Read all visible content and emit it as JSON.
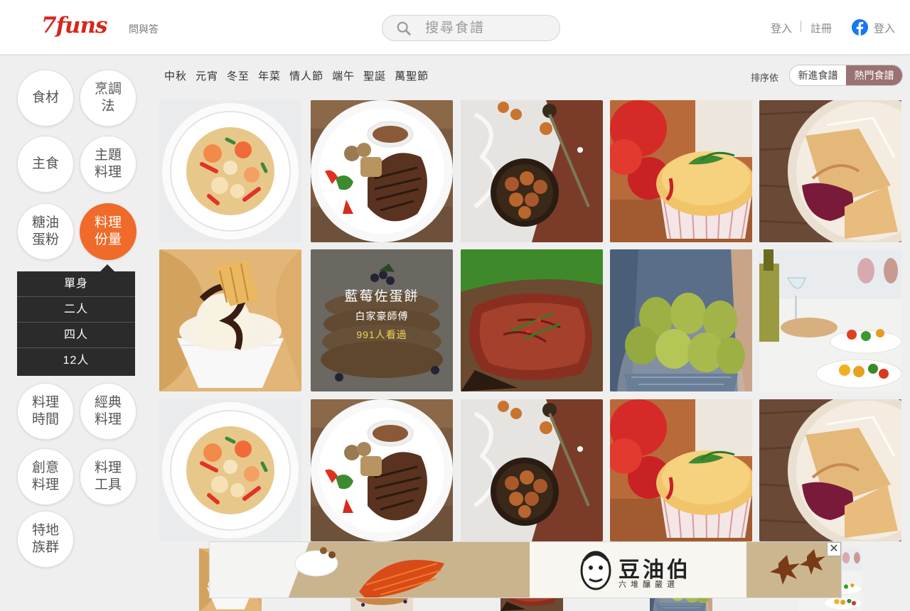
{
  "header": {
    "logo": "7funs",
    "qa_link": "問與答",
    "search_placeholder": "搜尋食譜",
    "login": "登入",
    "register": "註冊",
    "fb_login": "登入"
  },
  "sidebar": {
    "categories": [
      {
        "label": "食材"
      },
      {
        "label": "烹調\n法"
      },
      {
        "label": "主食"
      },
      {
        "label": "主題\n料理"
      },
      {
        "label": "糖油\n蛋粉"
      },
      {
        "label": "料理\n份量",
        "active": true
      },
      {
        "label": "料理\n時間"
      },
      {
        "label": "經典\n料理"
      },
      {
        "label": "創意\n料理"
      },
      {
        "label": "料理\n工具"
      },
      {
        "label": "特地\n族群"
      }
    ],
    "submenu": [
      "單身",
      "二人",
      "四人",
      "12人"
    ]
  },
  "holidays": [
    "中秋",
    "元宵",
    "冬至",
    "年菜",
    "情人節",
    "端午",
    "聖誕",
    "萬聖節"
  ],
  "sort": {
    "label": "排序依",
    "options": [
      "新進食譜",
      "熱門食譜"
    ],
    "active": "熱門食譜"
  },
  "featured": {
    "title": "藍莓佐蛋餅",
    "chef": "白家豪師傅",
    "views": "991人看過"
  },
  "ad": {
    "brand": "豆油伯",
    "tagline": "六堆釀嚴選",
    "close": "✕"
  },
  "colors": {
    "brand_red": "#d7261e",
    "active_orange": "#f06a2a",
    "sort_active": "#9a7272",
    "views_yellow": "#f3d35a"
  }
}
